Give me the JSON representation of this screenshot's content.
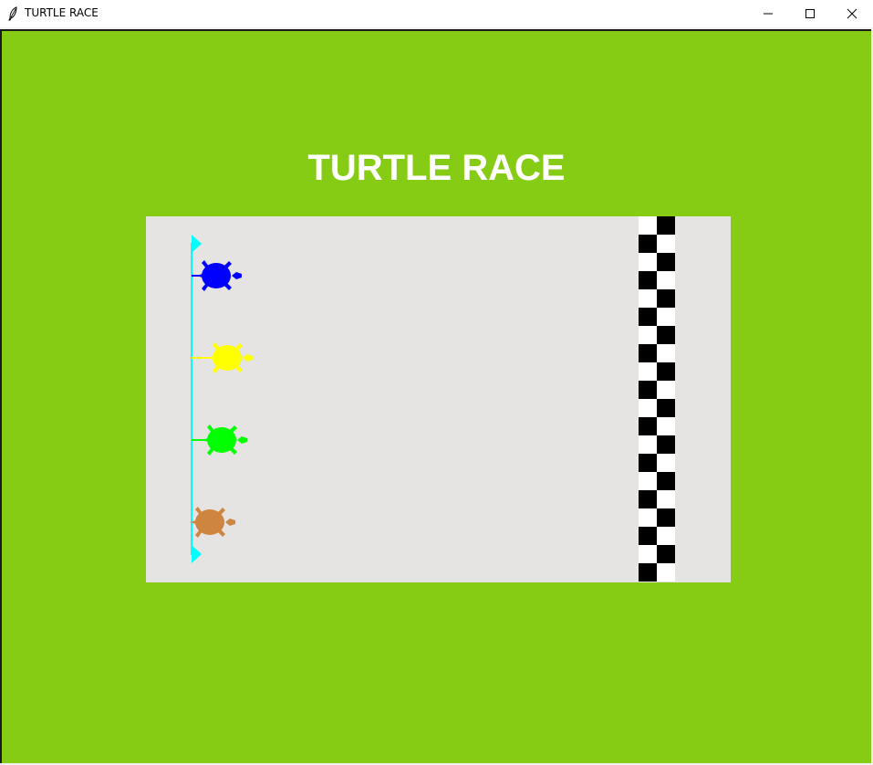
{
  "window": {
    "title": "TURTLE RACE",
    "icon": "feather-icon",
    "controls": [
      "minimize-icon",
      "maximize-icon",
      "close-icon"
    ]
  },
  "game": {
    "title": "TURTLE RACE",
    "background_color": "#87cc14",
    "track_color": "#e5e4e3",
    "start_line_color": "#00ffff",
    "finish_line_colors": [
      "#000000",
      "#ffffff"
    ],
    "turtles": [
      {
        "name": "blue",
        "color": "#0000ff",
        "icon": "turtle-icon"
      },
      {
        "name": "yellow",
        "color": "#ffff00",
        "icon": "turtle-icon"
      },
      {
        "name": "green",
        "color": "#00ff00",
        "icon": "turtle-icon"
      },
      {
        "name": "brown",
        "color": "#cd853f",
        "icon": "turtle-icon"
      }
    ]
  }
}
